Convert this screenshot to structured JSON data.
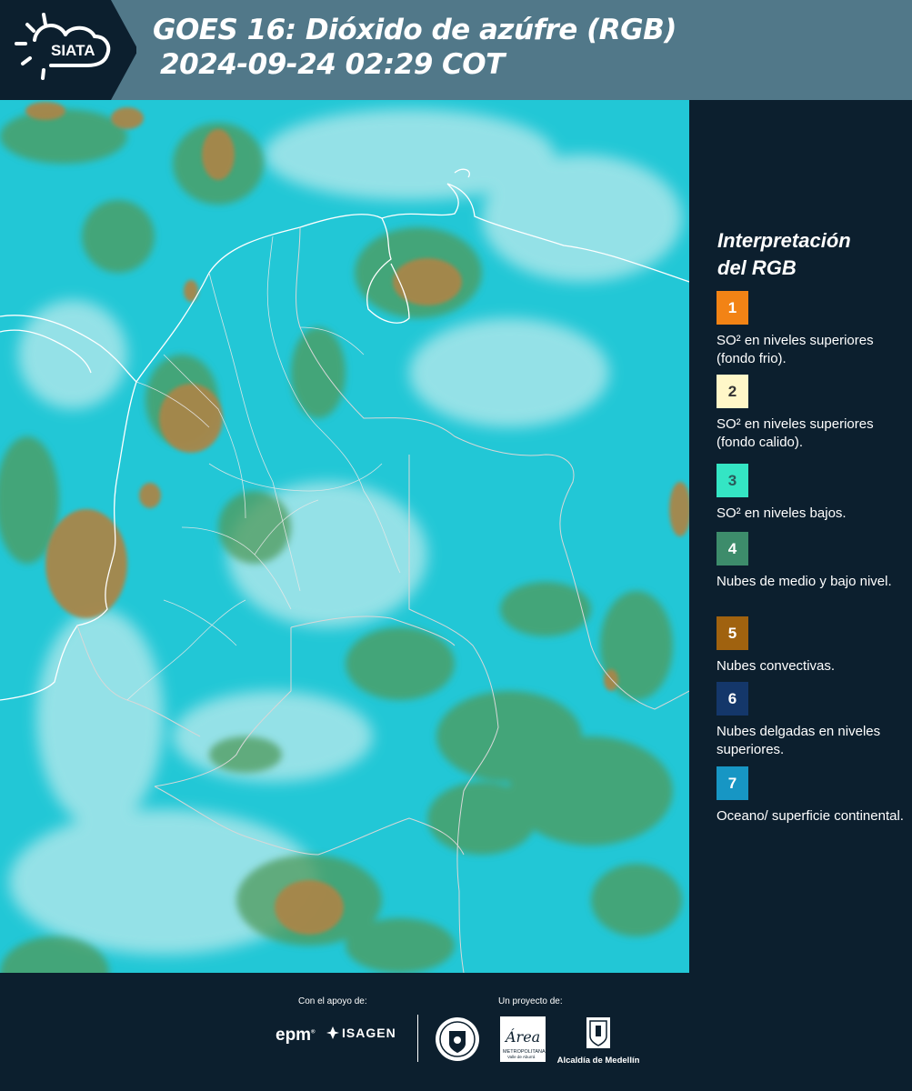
{
  "header": {
    "logo_text": "SIATA",
    "title_line1": "GOES 16: Dióxido de azúfre (RGB)",
    "title_line2": "2024-09-24 02:29 COT",
    "background_color": "#517889"
  },
  "legend": {
    "title_line1": "Interpretación",
    "title_line2": "del RGB",
    "items": [
      {
        "number": "1",
        "color": "#f28315",
        "text_color": "#ffffff",
        "label": "SO² en niveles superiores (fondo frio)."
      },
      {
        "number": "2",
        "color": "#fff7c8",
        "text_color": "#333333",
        "label": "SO² en niveles superiores (fondo calido)."
      },
      {
        "number": "3",
        "color": "#34e5c4",
        "text_color": "#2a5a5a",
        "label": "SO² en niveles bajos."
      },
      {
        "number": "4",
        "color": "#3d8c6b",
        "text_color": "#ffffff",
        "label": "Nubes de medio y bajo nivel."
      },
      {
        "number": "5",
        "color": "#a0620f",
        "text_color": "#ffffff",
        "label": "Nubes convectivas."
      },
      {
        "number": "6",
        "color": "#14376a",
        "text_color": "#ffffff",
        "label": "Nubes delgadas en niveles superiores."
      },
      {
        "number": "7",
        "color": "#1796c4",
        "text_color": "#ffffff",
        "label": "Oceano/ superficie continental."
      }
    ]
  },
  "footer": {
    "support_label": "Con el apoyo de:",
    "project_label": "Un proyecto de:",
    "sponsors": [
      "epm",
      "ISAGEN"
    ],
    "area_logo_text": "Área",
    "area_logo_sub": "METROPOLITANA",
    "area_logo_sub2": "Valle de Aburrá",
    "alcaldia_label": "Alcaldía de Medellín"
  },
  "map": {
    "ocean_color": "#22c7d6",
    "cloud_color": "#b8edf0",
    "green_cloud_color": "#4f9a5a",
    "convective_color": "#a8864a"
  }
}
